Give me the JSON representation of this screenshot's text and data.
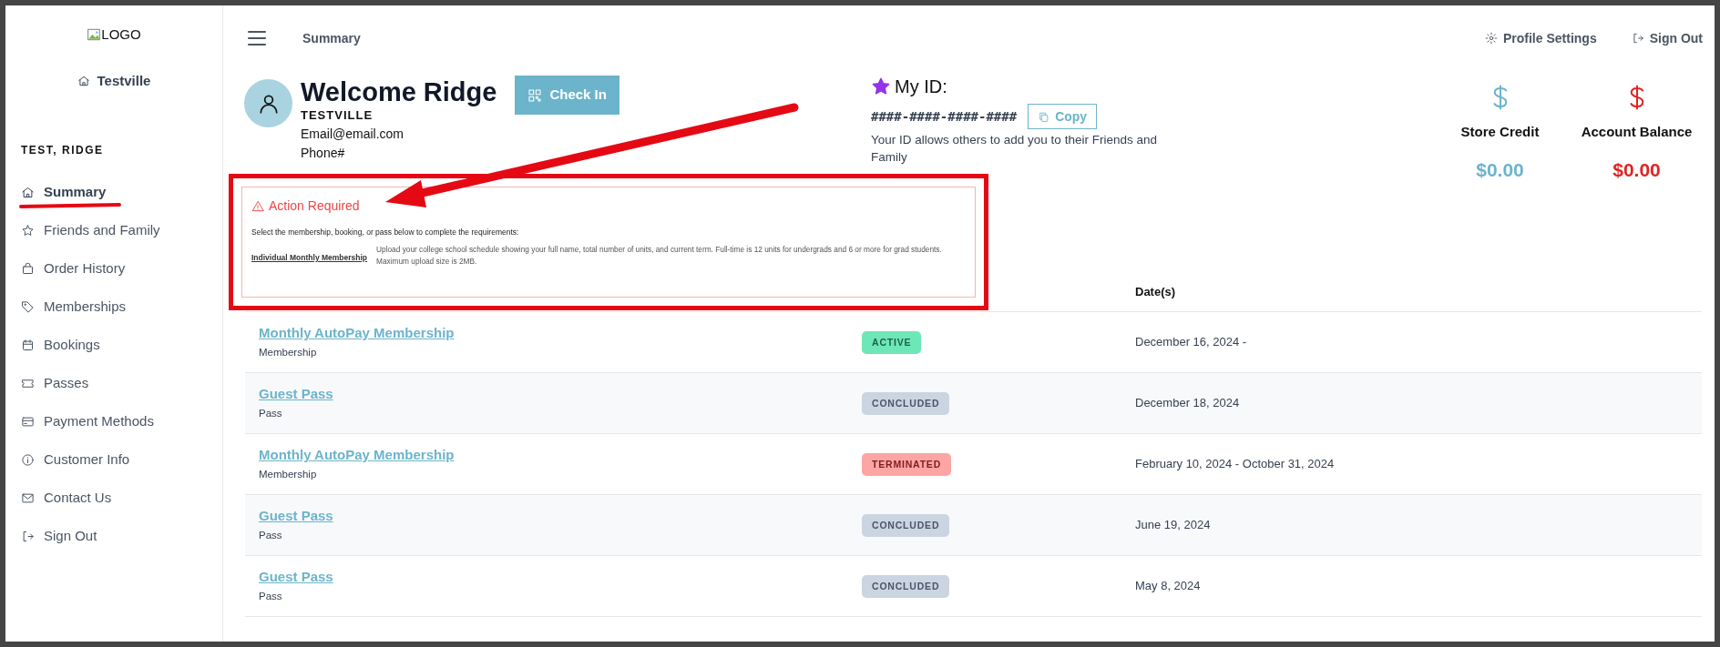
{
  "sidebar": {
    "logo_alt": "LOGO",
    "location": "Testville",
    "user": "TEST, RIDGE",
    "items": [
      {
        "label": "Summary",
        "selected": true
      },
      {
        "label": "Friends and Family",
        "selected": false
      },
      {
        "label": "Order History",
        "selected": false
      },
      {
        "label": "Memberships",
        "selected": false
      },
      {
        "label": "Bookings",
        "selected": false
      },
      {
        "label": "Passes",
        "selected": false
      },
      {
        "label": "Payment Methods",
        "selected": false
      },
      {
        "label": "Customer Info",
        "selected": false
      },
      {
        "label": "Contact Us",
        "selected": false
      },
      {
        "label": "Sign Out",
        "selected": false
      }
    ]
  },
  "header": {
    "page_title": "Summary",
    "links": [
      "Profile Settings",
      "Sign Out"
    ]
  },
  "profile": {
    "greeting": "Welcome Ridge",
    "location": "TESTVILLE",
    "email": "Email@email.com",
    "phone": "Phone#",
    "check_in": "Check In"
  },
  "my_id": {
    "title": "My ID:",
    "id": "####-####-####-####",
    "copy": "Copy",
    "description": "Your ID allows others to add you to their Friends and Family"
  },
  "balances": [
    {
      "label": "Store Credit",
      "value": "$0.00",
      "color": "#6cb4cb"
    },
    {
      "label": "Account Balance",
      "value": "$0.00",
      "color": "#e02424"
    }
  ],
  "action_required": {
    "title": "Action Required",
    "instruction": "Select the membership, booking, or pass below to complete the requirements:",
    "items": [
      {
        "name": "Individual Monthly Membership",
        "requirement": "Upload your college school schedule showing your full name, total number of units, and current term. Full-time is 12 units for undergrads and 6 or more for grad students. Maximum upload size is 2MB."
      }
    ]
  },
  "table": {
    "columns": [
      "Date(s)"
    ],
    "rows": [
      {
        "name": "Monthly AutoPay Membership",
        "type": "Membership",
        "status": "ACTIVE",
        "kind": "active",
        "dates": "December 16, 2024 -"
      },
      {
        "name": "Guest Pass",
        "type": "Pass",
        "status": "CONCLUDED",
        "kind": "concluded",
        "dates": "December 18, 2024"
      },
      {
        "name": "Monthly AutoPay Membership",
        "type": "Membership",
        "status": "TERMINATED",
        "kind": "terminated",
        "dates": "February 10, 2024 - October 31, 2024"
      },
      {
        "name": "Guest Pass",
        "type": "Pass",
        "status": "CONCLUDED",
        "kind": "concluded",
        "dates": "June 19, 2024"
      },
      {
        "name": "Guest Pass",
        "type": "Pass",
        "status": "CONCLUDED",
        "kind": "concluded",
        "dates": "May 8, 2024"
      }
    ]
  }
}
